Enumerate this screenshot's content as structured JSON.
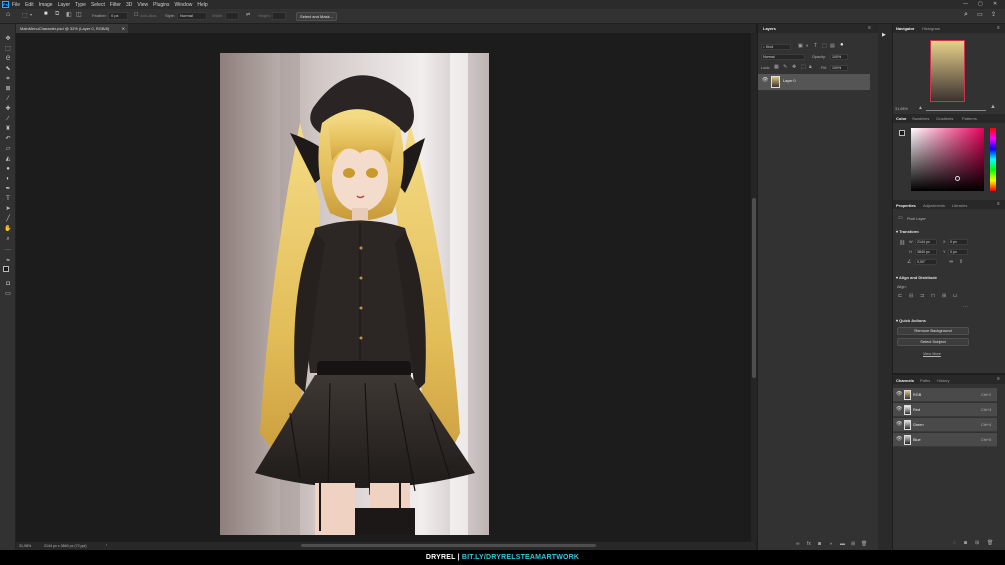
{
  "menu": [
    "File",
    "Edit",
    "Image",
    "Layer",
    "Type",
    "Select",
    "Filter",
    "3D",
    "View",
    "Plugins",
    "Window",
    "Help"
  ],
  "options": {
    "feather_label": "Feather:",
    "feather_value": "0 px",
    "antialias_label": "Anti-alias",
    "style_label": "Style:",
    "style_value": "Normal",
    "width_label": "Width:",
    "height_label": "Height:",
    "select_mask_button": "Select and Mask..."
  },
  "document": {
    "tab_title": "MainMenuCharacter.psd @ 32% (Layer 0, RGB/8)",
    "zoom": "31,98%",
    "dimensions": "2144 px x 3840 px (72 ppi)"
  },
  "layers_panel": {
    "title": "Layers",
    "kind_value": "Kind",
    "blend_mode": "Normal",
    "opacity_label": "Opacity:",
    "opacity_value": "100%",
    "lock_label": "Lock:",
    "fill_label": "Fill:",
    "fill_value": "100%",
    "layer_name": "Layer 0"
  },
  "navigator": {
    "tabs": [
      "Navigator",
      "Histogram"
    ],
    "zoom": "31,98%"
  },
  "color_panel": {
    "tabs": [
      "Color",
      "Swatches",
      "Gradients",
      "Patterns"
    ],
    "hue_color": "#e8005a"
  },
  "properties": {
    "tabs": [
      "Properties",
      "Adjustments",
      "Libraries"
    ],
    "layer_type": "Pixel Layer",
    "transform_title": "Transform",
    "w_label": "W",
    "w_value": "2144 px",
    "h_label": "H",
    "h_value": "3840 px",
    "x_label": "X",
    "x_value": "0 px",
    "y_label": "Y",
    "y_value": "0 px",
    "angle_value": "0,00°",
    "align_title": "Align and Distribute",
    "align_label": "Align:",
    "quick_actions_title": "Quick Actions",
    "remove_bg_button": "Remove Background",
    "select_subject_button": "Select Subject",
    "view_more_link": "View More"
  },
  "channels_panel": {
    "tabs": [
      "Channels",
      "Paths",
      "History"
    ],
    "channels": [
      {
        "name": "RGB",
        "shortcut": "Ctrl+2"
      },
      {
        "name": "Red",
        "shortcut": "Ctrl+3"
      },
      {
        "name": "Green",
        "shortcut": "Ctrl+4"
      },
      {
        "name": "Blue",
        "shortcut": "Ctrl+5"
      }
    ]
  },
  "credit": {
    "name": "DRYREL",
    "separator": " | ",
    "link": "BIT.LY/DRYRELSTEAMARTWORK",
    "link_color": "#33c9d6"
  }
}
